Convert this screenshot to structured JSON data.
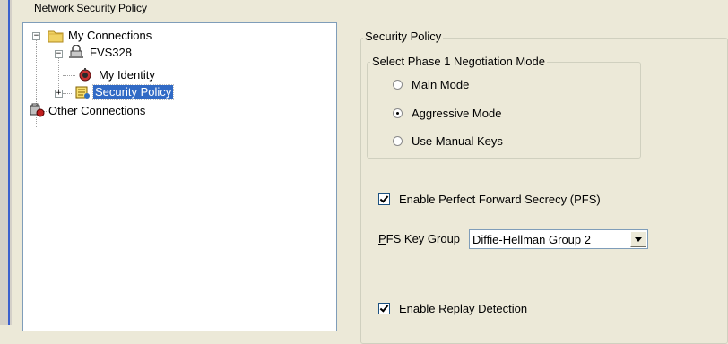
{
  "window": {
    "title": "Network Security Policy"
  },
  "tree": {
    "nodes": [
      {
        "label": "My Connections",
        "expander": "−",
        "icon": "folder-icon"
      },
      {
        "label": "FVS328",
        "expander": "−",
        "icon": "secure-connection-icon"
      },
      {
        "label": "My Identity",
        "icon": "identity-icon"
      },
      {
        "label": "Security Policy",
        "expander": "+",
        "icon": "policy-icon",
        "selected": true
      },
      {
        "label": "Other Connections",
        "icon": "other-connections-icon"
      }
    ]
  },
  "security_policy": {
    "group_title": "Security Policy",
    "phase1": {
      "title": "Select Phase 1 Negotiation Mode",
      "options": [
        {
          "label": "Main Mode",
          "selected": false
        },
        {
          "label": "Aggressive Mode",
          "selected": true
        },
        {
          "label": "Use Manual Keys",
          "selected": false
        }
      ]
    },
    "pfs": {
      "label": "Enable Perfect Forward Secrecy (PFS)",
      "checked": true
    },
    "pfs_key_group": {
      "label_prefix": "P",
      "label_rest": "FS Key Group",
      "value": "Diffie-Hellman Group 2"
    },
    "replay": {
      "label": "Enable Replay Detection",
      "checked": true
    }
  }
}
